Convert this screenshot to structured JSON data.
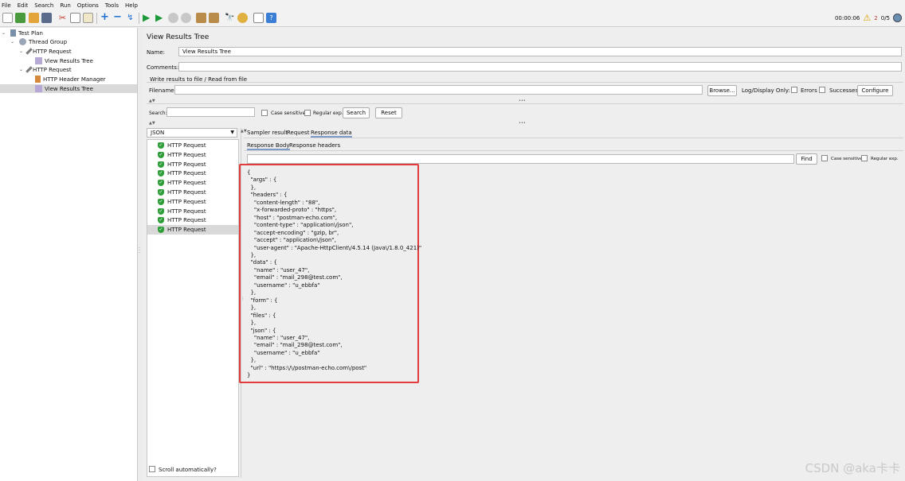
{
  "menu": [
    "File",
    "Edit",
    "Search",
    "Run",
    "Options",
    "Tools",
    "Help"
  ],
  "toolbar": {
    "timer": "00:00:06",
    "warning_count": "2",
    "threads": "0/5"
  },
  "tree": {
    "items": [
      {
        "label": "Test Plan"
      },
      {
        "label": "Thread Group"
      },
      {
        "label": "HTTP Request"
      },
      {
        "label": "View Results Tree"
      },
      {
        "label": "HTTP Request"
      },
      {
        "label": "HTTP Header Manager"
      },
      {
        "label": "View Results Tree"
      }
    ]
  },
  "panel": {
    "title": "View Results Tree",
    "name_label": "Name:",
    "name_value": "View Results Tree",
    "comments_label": "Comments:",
    "write_results_label": "Write results to file / Read from file",
    "filename_label": "Filename",
    "browse_label": "Browse...",
    "log_display_label": "Log/Display Only:",
    "errors_label": "Errors",
    "successes_label": "Successes",
    "configure_label": "Configure",
    "search_label": "Search:",
    "case_sensitive_label": "Case sensitive",
    "regular_exp_label": "Regular exp.",
    "search_button": "Search",
    "reset_button": "Reset",
    "renderer_value": "JSON",
    "scroll_auto_label": "Scroll automatically?"
  },
  "results": {
    "items": [
      "HTTP Request",
      "HTTP Request",
      "HTTP Request",
      "HTTP Request",
      "HTTP Request",
      "HTTP Request",
      "HTTP Request",
      "HTTP Request",
      "HTTP Request",
      "HTTP Request"
    ]
  },
  "tabs": {
    "main": [
      "Sampler result",
      "Request",
      "Response data"
    ],
    "sub": [
      "Response Body",
      "Response headers"
    ]
  },
  "find": {
    "find_button": "Find",
    "case_sensitive_label": "Case sensitive",
    "regular_exp_label": "Regular exp."
  },
  "response_body": "{\n  \"args\" : {\n  },\n  \"headers\" : {\n    \"content-length\" : \"88\",\n    \"x-forwarded-proto\" : \"https\",\n    \"host\" : \"postman-echo.com\",\n    \"content-type\" : \"application\\/json\",\n    \"accept-encoding\" : \"gzip, br\",\n    \"accept\" : \"application\\/json\",\n    \"user-agent\" : \"Apache-HttpClient\\/4.5.14 (Java\\/1.8.0_421)\"\n  },\n  \"data\" : {\n    \"name\" : \"user_47\",\n    \"email\" : \"mail_298@test.com\",\n    \"username\" : \"u_ebbfa\"\n  },\n  \"form\" : {\n  },\n  \"files\" : {\n  },\n  \"json\" : {\n    \"name\" : \"user_47\",\n    \"email\" : \"mail_298@test.com\",\n    \"username\" : \"u_ebbfa\"\n  },\n  \"url\" : \"https:\\/\\/postman-echo.com\\/post\"\n}",
  "watermark": "CSDN @aka卡卡",
  "colors": {
    "highlight_box": "#e23b3b",
    "selection": "#d9d9d9",
    "success_icon": "#2f9e3a",
    "run_icon": "#1c9a3a"
  }
}
